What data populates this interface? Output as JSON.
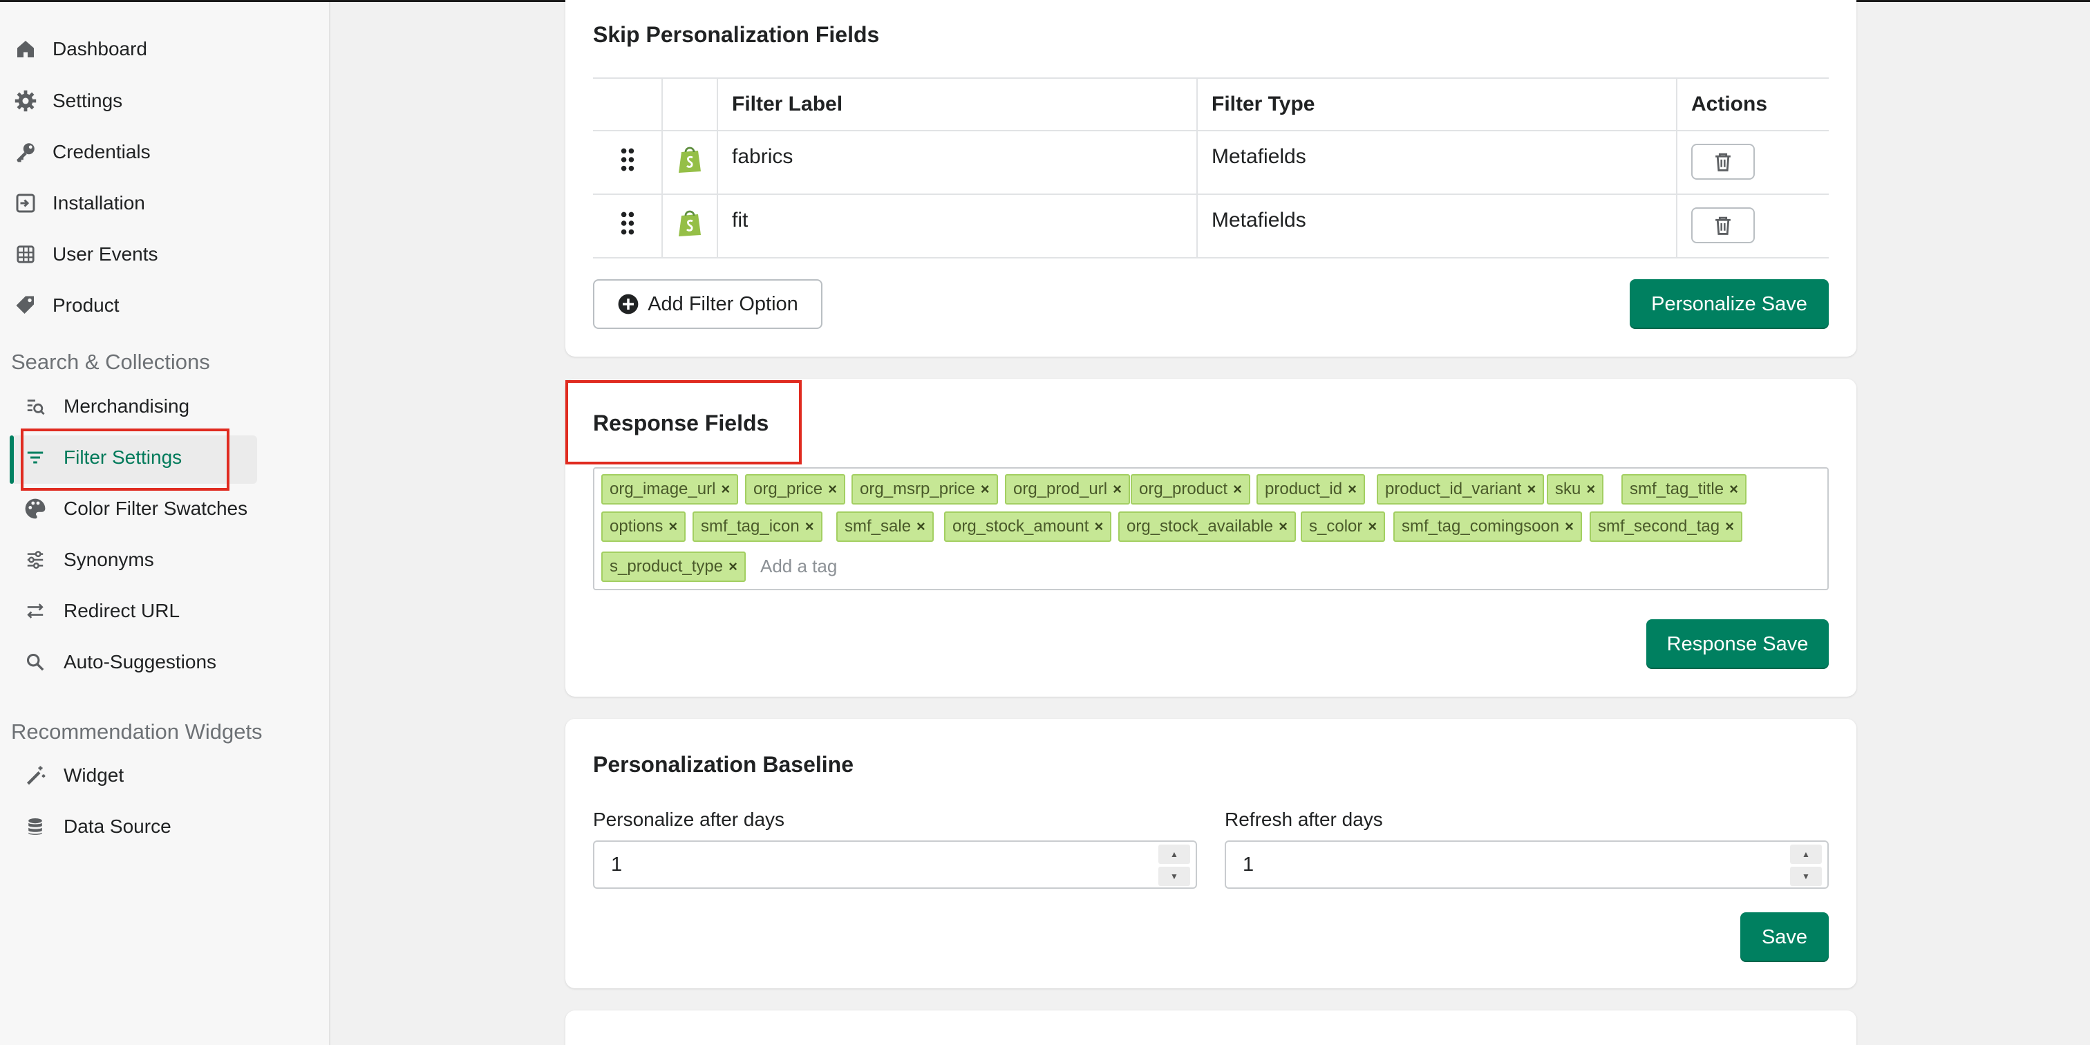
{
  "sidebar": {
    "items": [
      {
        "label": "Dashboard",
        "icon": "home-icon"
      },
      {
        "label": "Settings",
        "icon": "gear-icon"
      },
      {
        "label": "Credentials",
        "icon": "key-icon"
      },
      {
        "label": "Installation",
        "icon": "install-icon"
      },
      {
        "label": "User Events",
        "icon": "table-icon"
      },
      {
        "label": "Product",
        "icon": "tag-icon"
      }
    ],
    "section_search": "Search & Collections",
    "search_items": [
      {
        "label": "Merchandising",
        "icon": "search-list-icon"
      },
      {
        "label": "Filter Settings",
        "icon": "filter-icon"
      },
      {
        "label": "Color Filter Swatches",
        "icon": "palette-icon"
      },
      {
        "label": "Synonyms",
        "icon": "sliders-icon"
      },
      {
        "label": "Redirect URL",
        "icon": "arrows-icon"
      },
      {
        "label": "Auto-Suggestions",
        "icon": "search-icon"
      }
    ],
    "section_reco": "Recommendation Widgets",
    "reco_items": [
      {
        "label": "Widget",
        "icon": "magic-wand-icon"
      },
      {
        "label": "Data Source",
        "icon": "database-icon"
      }
    ]
  },
  "skip_card": {
    "title": "Skip Personalization Fields",
    "columns": [
      "Filter Label",
      "Filter Type",
      "Actions"
    ],
    "rows": [
      {
        "label": "fabrics",
        "type": "Metafields"
      },
      {
        "label": "fit",
        "type": "Metafields"
      }
    ],
    "add_button": "Add Filter Option",
    "save_button": "Personalize Save"
  },
  "response_card": {
    "title": "Response Fields",
    "tags": [
      "org_image_url",
      "org_price",
      "org_msrp_price",
      "org_prod_url",
      "org_product",
      "product_id",
      "product_id_variant",
      "sku",
      "smf_tag_title",
      "options",
      "smf_tag_icon",
      "smf_sale",
      "org_stock_amount",
      "org_stock_available",
      "s_color",
      "smf_tag_comingsoon",
      "smf_second_tag",
      "s_product_type"
    ],
    "tag_remove": "×",
    "placeholder": "Add a tag",
    "save_button": "Response Save"
  },
  "baseline_card": {
    "title": "Personalization Baseline",
    "personalize_label": "Personalize after days",
    "personalize_value": "1",
    "refresh_label": "Refresh after days",
    "refresh_value": "1",
    "save_button": "Save"
  },
  "colors": {
    "accent": "#008060",
    "tag_bg": "#c6e795",
    "highlight": "#e02b20"
  }
}
